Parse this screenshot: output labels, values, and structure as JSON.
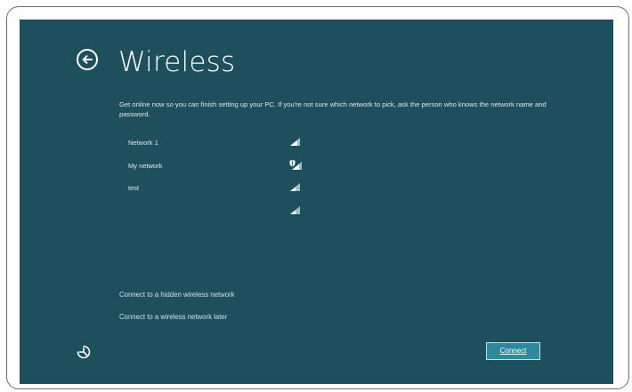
{
  "window": {
    "background_color": "#1e4f5c",
    "accent_button_color": "#2c8a9b"
  },
  "header": {
    "back_icon": "back-arrow-icon",
    "title": "Wireless"
  },
  "description": "Get online now so you can finish setting up your PC. If you're not sure which network to pick, ask the person who knows the network name and password.",
  "networks": [
    {
      "name": "Network 1",
      "icon": "wifi-signal-icon",
      "secured": false
    },
    {
      "name": "My network",
      "icon": "wifi-shield-signal-icon",
      "secured": true
    },
    {
      "name": "test",
      "icon": "wifi-signal-icon",
      "secured": false
    },
    {
      "name": "",
      "icon": "wifi-signal-icon",
      "secured": false
    }
  ],
  "links": {
    "hidden_network": "Connect to a hidden wireless network",
    "later": "Connect to a wireless network later"
  },
  "footer": {
    "ease_of_access_icon": "ease-of-access-icon",
    "connect_label": "Connect"
  }
}
